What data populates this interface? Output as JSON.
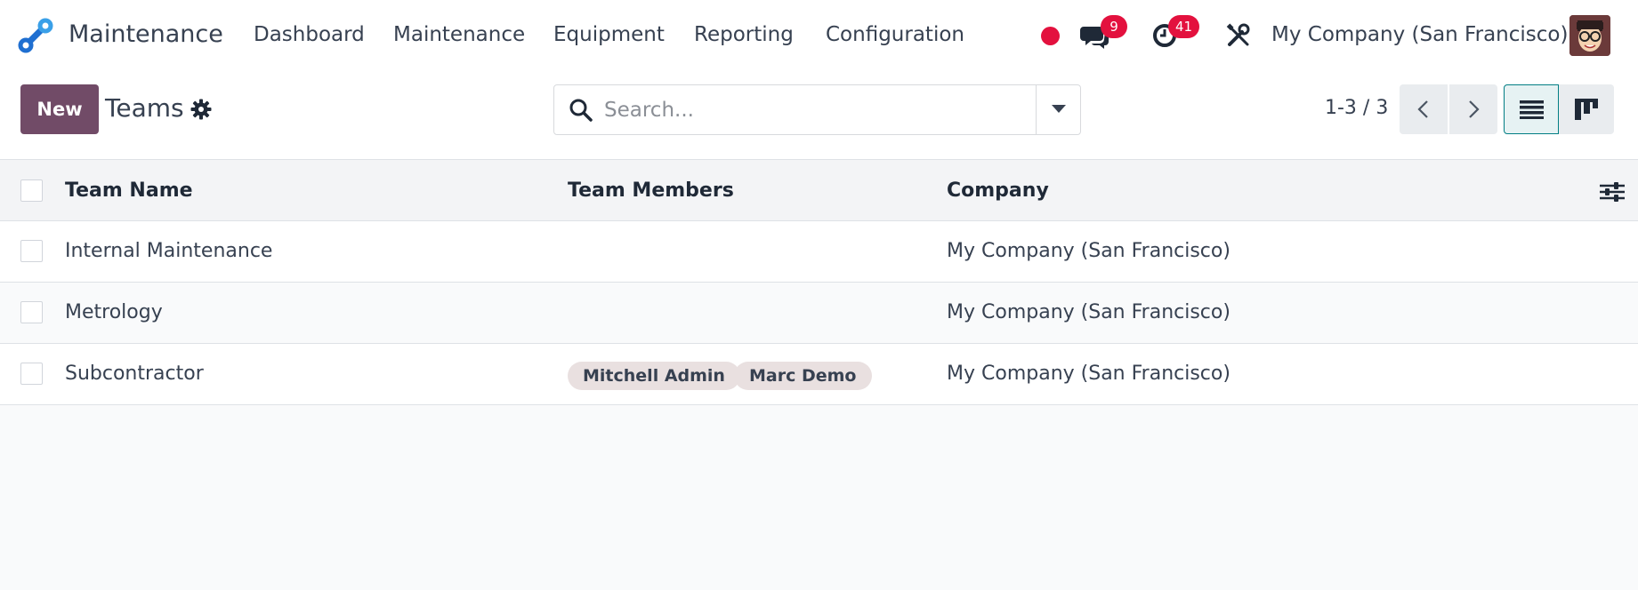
{
  "app": {
    "name": "Maintenance"
  },
  "menu": [
    "Dashboard",
    "Maintenance",
    "Equipment",
    "Reporting",
    "Configuration"
  ],
  "systray": {
    "messages_count": "9",
    "activities_count": "41",
    "company": "My Company (San Francisco)"
  },
  "control": {
    "new_label": "New",
    "title": "Teams",
    "search_placeholder": "Search...",
    "pager": "1-3 / 3"
  },
  "table": {
    "columns": [
      "Team Name",
      "Team Members",
      "Company"
    ],
    "rows": [
      {
        "name": "Internal Maintenance",
        "members": [],
        "company": "My Company (San Francisco)"
      },
      {
        "name": "Metrology",
        "members": [],
        "company": "My Company (San Francisco)"
      },
      {
        "name": "Subcontractor",
        "members": [
          "Mitchell Admin",
          "Marc Demo"
        ],
        "company": "My Company (San Francisco)"
      }
    ]
  },
  "colors": {
    "brand": "#714b67",
    "badge": "#e3113e",
    "tag_bg": "#e9e0e0"
  }
}
